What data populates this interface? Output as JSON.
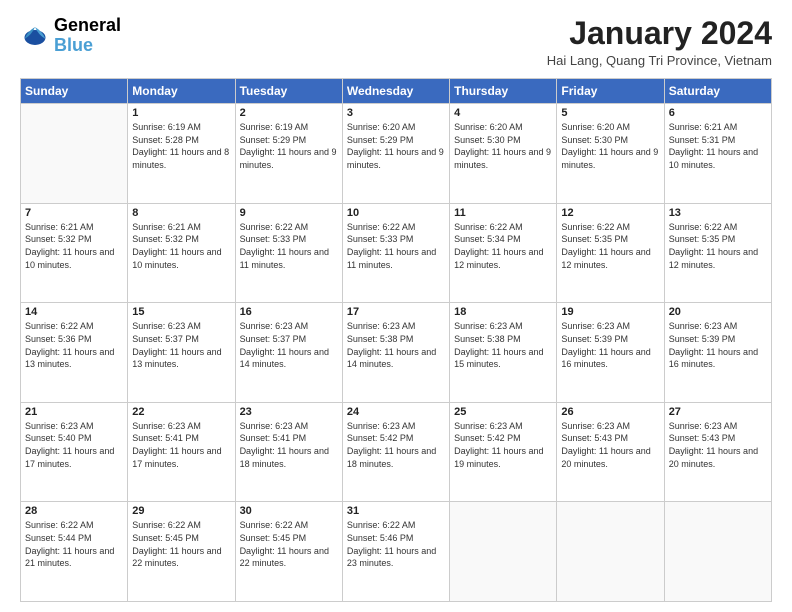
{
  "header": {
    "logo_line1": "General",
    "logo_line2": "Blue",
    "main_title": "January 2024",
    "subtitle": "Hai Lang, Quang Tri Province, Vietnam"
  },
  "calendar": {
    "days_of_week": [
      "Sunday",
      "Monday",
      "Tuesday",
      "Wednesday",
      "Thursday",
      "Friday",
      "Saturday"
    ],
    "weeks": [
      [
        {
          "day": "",
          "info": ""
        },
        {
          "day": "1",
          "info": "Sunrise: 6:19 AM\nSunset: 5:28 PM\nDaylight: 11 hours\nand 8 minutes."
        },
        {
          "day": "2",
          "info": "Sunrise: 6:19 AM\nSunset: 5:29 PM\nDaylight: 11 hours\nand 9 minutes."
        },
        {
          "day": "3",
          "info": "Sunrise: 6:20 AM\nSunset: 5:29 PM\nDaylight: 11 hours\nand 9 minutes."
        },
        {
          "day": "4",
          "info": "Sunrise: 6:20 AM\nSunset: 5:30 PM\nDaylight: 11 hours\nand 9 minutes."
        },
        {
          "day": "5",
          "info": "Sunrise: 6:20 AM\nSunset: 5:30 PM\nDaylight: 11 hours\nand 9 minutes."
        },
        {
          "day": "6",
          "info": "Sunrise: 6:21 AM\nSunset: 5:31 PM\nDaylight: 11 hours\nand 10 minutes."
        }
      ],
      [
        {
          "day": "7",
          "info": "Sunrise: 6:21 AM\nSunset: 5:32 PM\nDaylight: 11 hours\nand 10 minutes."
        },
        {
          "day": "8",
          "info": "Sunrise: 6:21 AM\nSunset: 5:32 PM\nDaylight: 11 hours\nand 10 minutes."
        },
        {
          "day": "9",
          "info": "Sunrise: 6:22 AM\nSunset: 5:33 PM\nDaylight: 11 hours\nand 11 minutes."
        },
        {
          "day": "10",
          "info": "Sunrise: 6:22 AM\nSunset: 5:33 PM\nDaylight: 11 hours\nand 11 minutes."
        },
        {
          "day": "11",
          "info": "Sunrise: 6:22 AM\nSunset: 5:34 PM\nDaylight: 11 hours\nand 12 minutes."
        },
        {
          "day": "12",
          "info": "Sunrise: 6:22 AM\nSunset: 5:35 PM\nDaylight: 11 hours\nand 12 minutes."
        },
        {
          "day": "13",
          "info": "Sunrise: 6:22 AM\nSunset: 5:35 PM\nDaylight: 11 hours\nand 12 minutes."
        }
      ],
      [
        {
          "day": "14",
          "info": "Sunrise: 6:22 AM\nSunset: 5:36 PM\nDaylight: 11 hours\nand 13 minutes."
        },
        {
          "day": "15",
          "info": "Sunrise: 6:23 AM\nSunset: 5:37 PM\nDaylight: 11 hours\nand 13 minutes."
        },
        {
          "day": "16",
          "info": "Sunrise: 6:23 AM\nSunset: 5:37 PM\nDaylight: 11 hours\nand 14 minutes."
        },
        {
          "day": "17",
          "info": "Sunrise: 6:23 AM\nSunset: 5:38 PM\nDaylight: 11 hours\nand 14 minutes."
        },
        {
          "day": "18",
          "info": "Sunrise: 6:23 AM\nSunset: 5:38 PM\nDaylight: 11 hours\nand 15 minutes."
        },
        {
          "day": "19",
          "info": "Sunrise: 6:23 AM\nSunset: 5:39 PM\nDaylight: 11 hours\nand 16 minutes."
        },
        {
          "day": "20",
          "info": "Sunrise: 6:23 AM\nSunset: 5:39 PM\nDaylight: 11 hours\nand 16 minutes."
        }
      ],
      [
        {
          "day": "21",
          "info": "Sunrise: 6:23 AM\nSunset: 5:40 PM\nDaylight: 11 hours\nand 17 minutes."
        },
        {
          "day": "22",
          "info": "Sunrise: 6:23 AM\nSunset: 5:41 PM\nDaylight: 11 hours\nand 17 minutes."
        },
        {
          "day": "23",
          "info": "Sunrise: 6:23 AM\nSunset: 5:41 PM\nDaylight: 11 hours\nand 18 minutes."
        },
        {
          "day": "24",
          "info": "Sunrise: 6:23 AM\nSunset: 5:42 PM\nDaylight: 11 hours\nand 18 minutes."
        },
        {
          "day": "25",
          "info": "Sunrise: 6:23 AM\nSunset: 5:42 PM\nDaylight: 11 hours\nand 19 minutes."
        },
        {
          "day": "26",
          "info": "Sunrise: 6:23 AM\nSunset: 5:43 PM\nDaylight: 11 hours\nand 20 minutes."
        },
        {
          "day": "27",
          "info": "Sunrise: 6:23 AM\nSunset: 5:43 PM\nDaylight: 11 hours\nand 20 minutes."
        }
      ],
      [
        {
          "day": "28",
          "info": "Sunrise: 6:22 AM\nSunset: 5:44 PM\nDaylight: 11 hours\nand 21 minutes."
        },
        {
          "day": "29",
          "info": "Sunrise: 6:22 AM\nSunset: 5:45 PM\nDaylight: 11 hours\nand 22 minutes."
        },
        {
          "day": "30",
          "info": "Sunrise: 6:22 AM\nSunset: 5:45 PM\nDaylight: 11 hours\nand 22 minutes."
        },
        {
          "day": "31",
          "info": "Sunrise: 6:22 AM\nSunset: 5:46 PM\nDaylight: 11 hours\nand 23 minutes."
        },
        {
          "day": "",
          "info": ""
        },
        {
          "day": "",
          "info": ""
        },
        {
          "day": "",
          "info": ""
        }
      ]
    ]
  }
}
